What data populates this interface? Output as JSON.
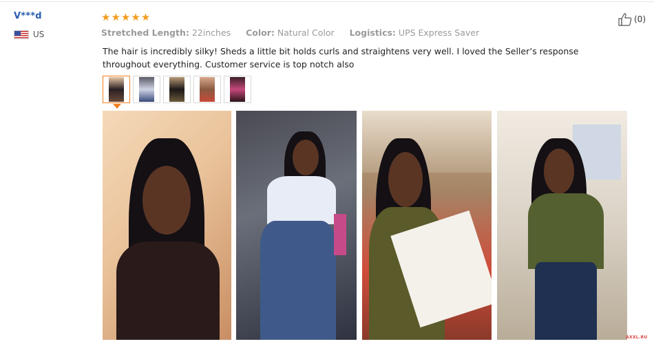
{
  "user": {
    "name": "V***d",
    "country": "US"
  },
  "rating": {
    "stars": 5,
    "star_glyph": "★"
  },
  "meta": {
    "length_label": "Stretched Length:",
    "length_value": "22inches",
    "color_label": "Color:",
    "color_value": "Natural Color",
    "logistics_label": "Logistics:",
    "logistics_value": "UPS Express Saver"
  },
  "review": {
    "text": "The hair is incredibly silky! Sheds a little bit holds curls and straightens very well. I loved the Seller’s response throughout everything. Customer service is top notch also"
  },
  "helpful": {
    "count": "(0)",
    "icon": "thumbs-up-icon"
  },
  "thumbnails": {
    "count": 5,
    "selected_index": 0
  },
  "photos": {
    "count": 4
  },
  "watermark": "AXXL.RU",
  "colors": {
    "username": "#2a5db0",
    "star": "#f29c1f",
    "active_thumb": "#f07e1f"
  }
}
